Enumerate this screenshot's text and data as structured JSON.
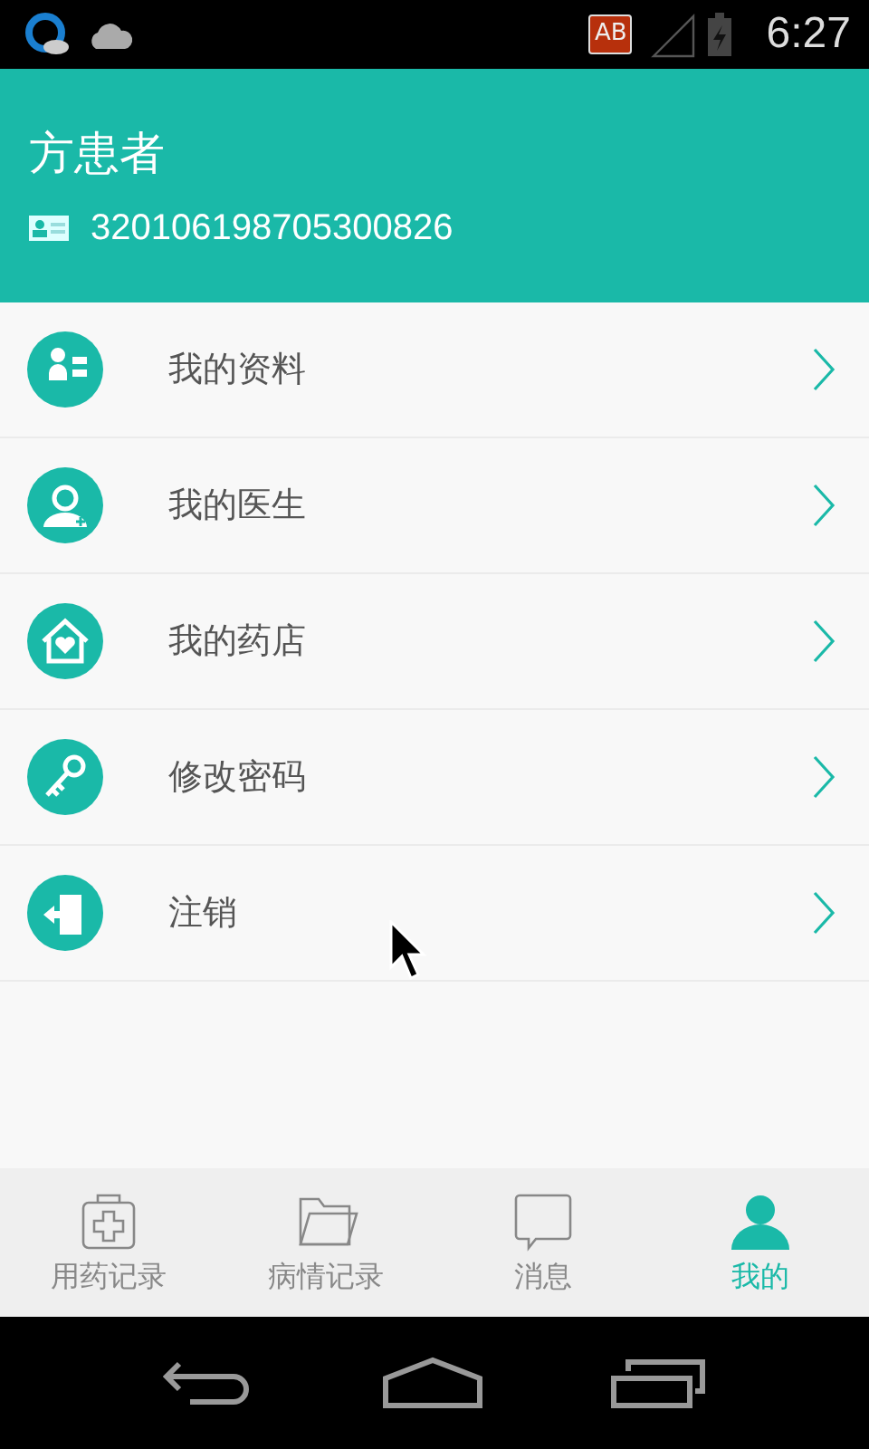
{
  "status_bar": {
    "badge": "AB",
    "time": "6:27"
  },
  "profile": {
    "name": "方患者",
    "id_number": "320106198705300826"
  },
  "menu": [
    {
      "kind": "profile",
      "label": "我的资料"
    },
    {
      "kind": "doctor",
      "label": "我的医生"
    },
    {
      "kind": "pharmacy",
      "label": "我的药店"
    },
    {
      "kind": "password",
      "label": "修改密码"
    },
    {
      "kind": "logout",
      "label": "注销"
    }
  ],
  "tabs": [
    {
      "kind": "medkit",
      "label": "用药记录",
      "selected": false
    },
    {
      "kind": "folder",
      "label": "病情记录",
      "selected": false
    },
    {
      "kind": "message",
      "label": "消息",
      "selected": false
    },
    {
      "kind": "person",
      "label": "我的",
      "selected": true
    }
  ]
}
